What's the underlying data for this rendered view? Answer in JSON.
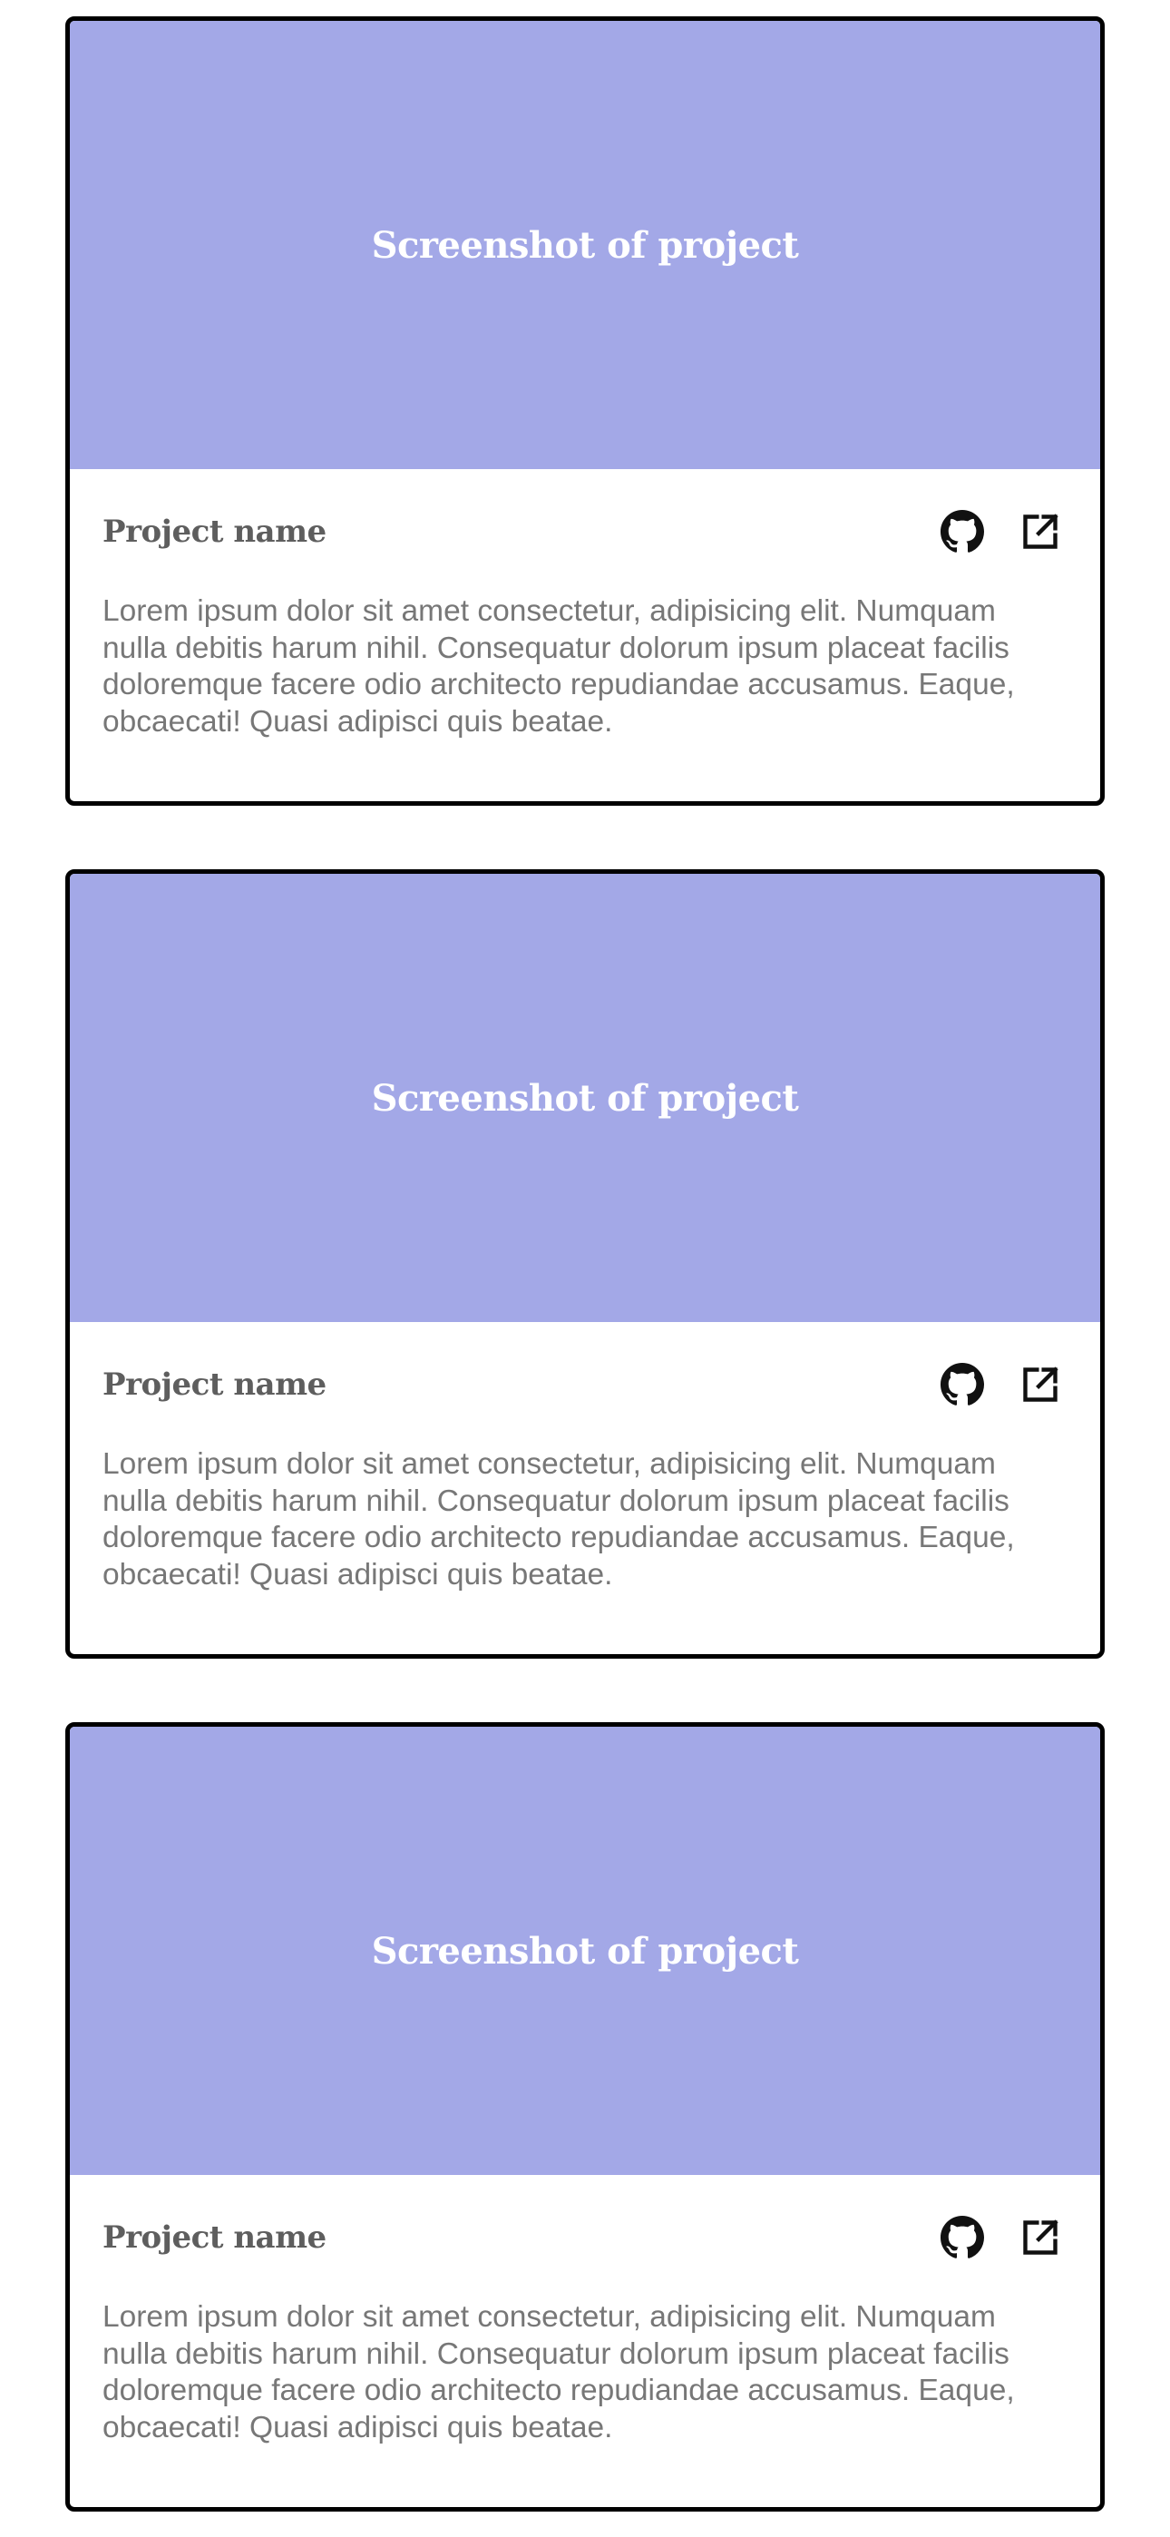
{
  "projects": [
    {
      "screenshot_label": "Screenshot of project",
      "name": "Project name",
      "description": "Lorem ipsum dolor sit amet consectetur, adipisicing elit. Numquam nulla debitis harum nihil. Consequatur dolorum ipsum placeat facilis doloremque facere odio architecto repudiandae accusamus. Eaque, obcaecati! Quasi adipisci quis beatae.",
      "icons": [
        "github-icon",
        "external-link-icon"
      ]
    },
    {
      "screenshot_label": "Screenshot of project",
      "name": "Project name",
      "description": "Lorem ipsum dolor sit amet consectetur, adipisicing elit. Numquam nulla debitis harum nihil. Consequatur dolorum ipsum placeat facilis doloremque facere odio architecto repudiandae accusamus. Eaque, obcaecati! Quasi adipisci quis beatae.",
      "icons": [
        "github-icon",
        "external-link-icon"
      ]
    },
    {
      "screenshot_label": "Screenshot of project",
      "name": "Project name",
      "description": "Lorem ipsum dolor sit amet consectetur, adipisicing elit. Numquam nulla debitis harum nihil. Consequatur dolorum ipsum placeat facilis doloremque facere odio architecto repudiandae accusamus. Eaque, obcaecati! Quasi adipisci quis beatae.",
      "icons": [
        "github-icon",
        "external-link-icon"
      ]
    }
  ],
  "colors": {
    "screenshot_bg": "#a3a8e7",
    "card_border": "#000000",
    "name_text": "#5e5e5e",
    "description_text": "#777777"
  }
}
